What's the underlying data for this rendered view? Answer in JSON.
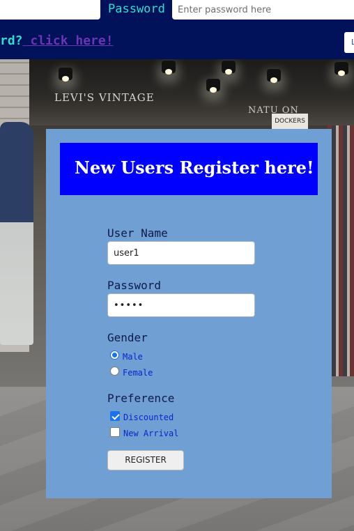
{
  "header": {
    "password_label": "Password",
    "password_placeholder": "Enter password here",
    "forgot_prefix": "rd?",
    "forgot_link": " click here! ",
    "login_button": "L"
  },
  "background": {
    "sign_main": "LEVI'S VINTAGE",
    "sign_side": "NATU    ON",
    "sign_dockers": "DOCKERS"
  },
  "register_form": {
    "title": "New Users Register here!",
    "username_label": "User Name",
    "username_value": "user1",
    "password_label": "Password",
    "password_value": "•••••",
    "gender_label": "Gender",
    "gender_options": [
      "Male",
      "Female"
    ],
    "gender_selected": "Male",
    "preference_label": "Preference",
    "preference_options": [
      "Discounted",
      "New Arrival"
    ],
    "preference_checked": [
      "Discounted"
    ],
    "submit_label": "REGISTER"
  },
  "colors": {
    "header_bg": "#01115a",
    "accent_text": "#2fe0d0",
    "link": "#6b35b4",
    "card_bg": "#709fd3",
    "title_bg": "#0000ff",
    "option_text": "#0a26c8"
  }
}
